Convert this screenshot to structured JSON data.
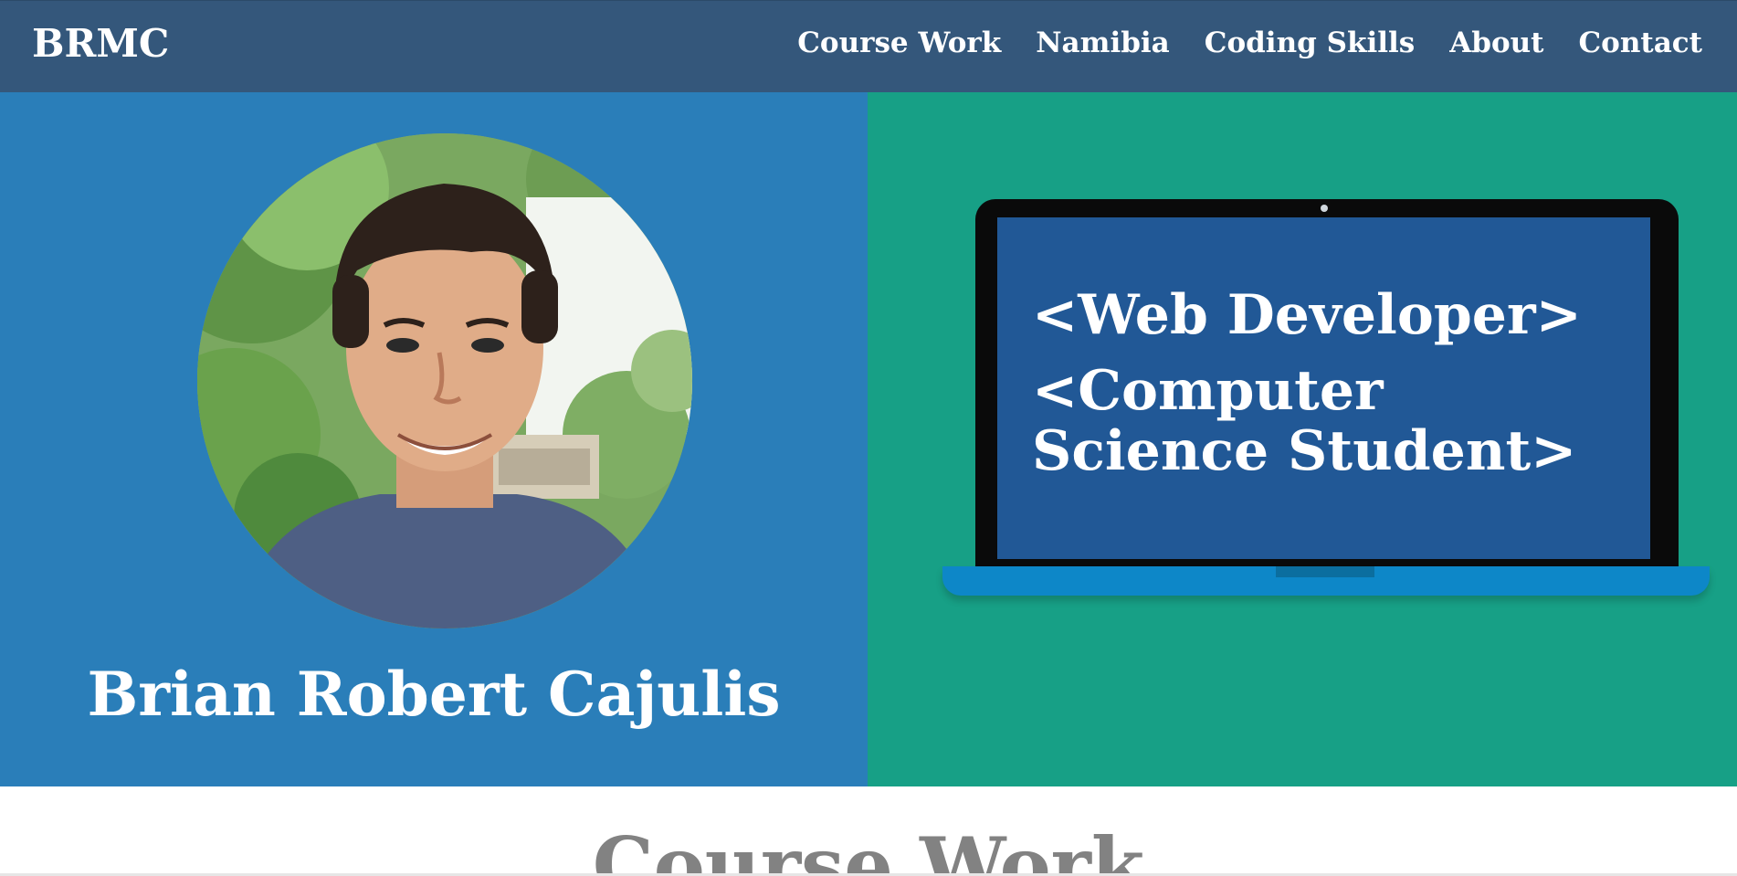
{
  "navbar": {
    "brand": "BRMC",
    "links": [
      {
        "label": "Course Work"
      },
      {
        "label": "Namibia"
      },
      {
        "label": "Coding Skills"
      },
      {
        "label": "About"
      },
      {
        "label": "Contact"
      }
    ]
  },
  "hero": {
    "name": "Brian Robert Cajulis",
    "screen_lines": [
      "<Web Developer>",
      "<Computer",
      "Science Student>"
    ]
  },
  "sections": {
    "first_title": "Course Work"
  },
  "colors": {
    "navbar": "#34577b",
    "hero_left": "#2a7eb9",
    "hero_right": "#17a086",
    "laptop_screen": "#215896",
    "laptop_base": "#0d87c8",
    "section_title": "#828282"
  },
  "icons": {
    "avatar": "profile-photo"
  }
}
